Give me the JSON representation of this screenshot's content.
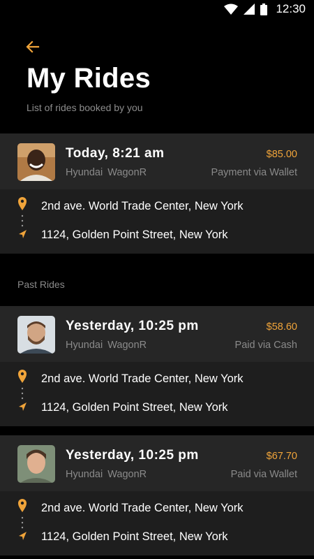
{
  "status_bar": {
    "time": "12:30"
  },
  "header": {
    "title": "My Rides",
    "subtitle": "List of rides booked by you"
  },
  "section": {
    "past_label": "Past Rides"
  },
  "colors": {
    "accent": "#f0a43a",
    "card_head": "#262626",
    "card_body": "#1e1e1e"
  },
  "rides": [
    {
      "time": "Today, 8:21 am",
      "car": "Hyundai  WagonR",
      "price": "$85.00",
      "payment": "Payment via Wallet",
      "from": "2nd ave. World Trade Center, New York",
      "to": "1124, Golden Point Street, New York"
    },
    {
      "time": "Yesterday, 10:25 pm",
      "car": "Hyundai  WagonR",
      "price": "$58.60",
      "payment": "Paid via Cash",
      "from": "2nd ave. World Trade Center, New York",
      "to": "1124, Golden Point Street, New York"
    },
    {
      "time": "Yesterday, 10:25 pm",
      "car": "Hyundai  WagonR",
      "price": "$67.70",
      "payment": "Paid via Wallet",
      "from": "2nd ave. World Trade Center, New York",
      "to": "1124, Golden Point Street, New York"
    }
  ]
}
